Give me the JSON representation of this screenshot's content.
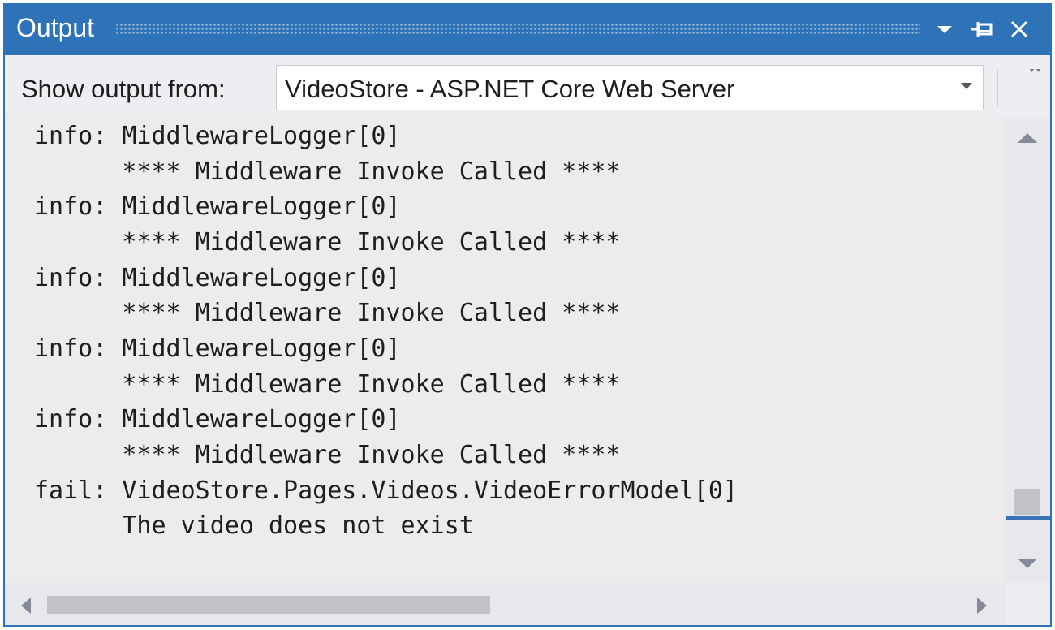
{
  "window": {
    "title": "Output",
    "colors": {
      "titlebar": "#2e73b8",
      "output_bg": "#ececec",
      "scroll_marker": "#3a72b6"
    },
    "icons": [
      "chevron-down-icon",
      "pin-icon",
      "close-icon"
    ]
  },
  "toolbar": {
    "show_output_label": "Show output from:",
    "source_selected": "VideoStore - ASP.NET Core Web Server"
  },
  "output": {
    "lines": [
      "info: MiddlewareLogger[0]",
      "      **** Middleware Invoke Called ****",
      "info: MiddlewareLogger[0]",
      "      **** Middleware Invoke Called ****",
      "info: MiddlewareLogger[0]",
      "      **** Middleware Invoke Called ****",
      "info: MiddlewareLogger[0]",
      "      **** Middleware Invoke Called ****",
      "info: MiddlewareLogger[0]",
      "      **** Middleware Invoke Called ****",
      "fail: VideoStore.Pages.Videos.VideoErrorModel[0]",
      "      The video does not exist"
    ]
  }
}
